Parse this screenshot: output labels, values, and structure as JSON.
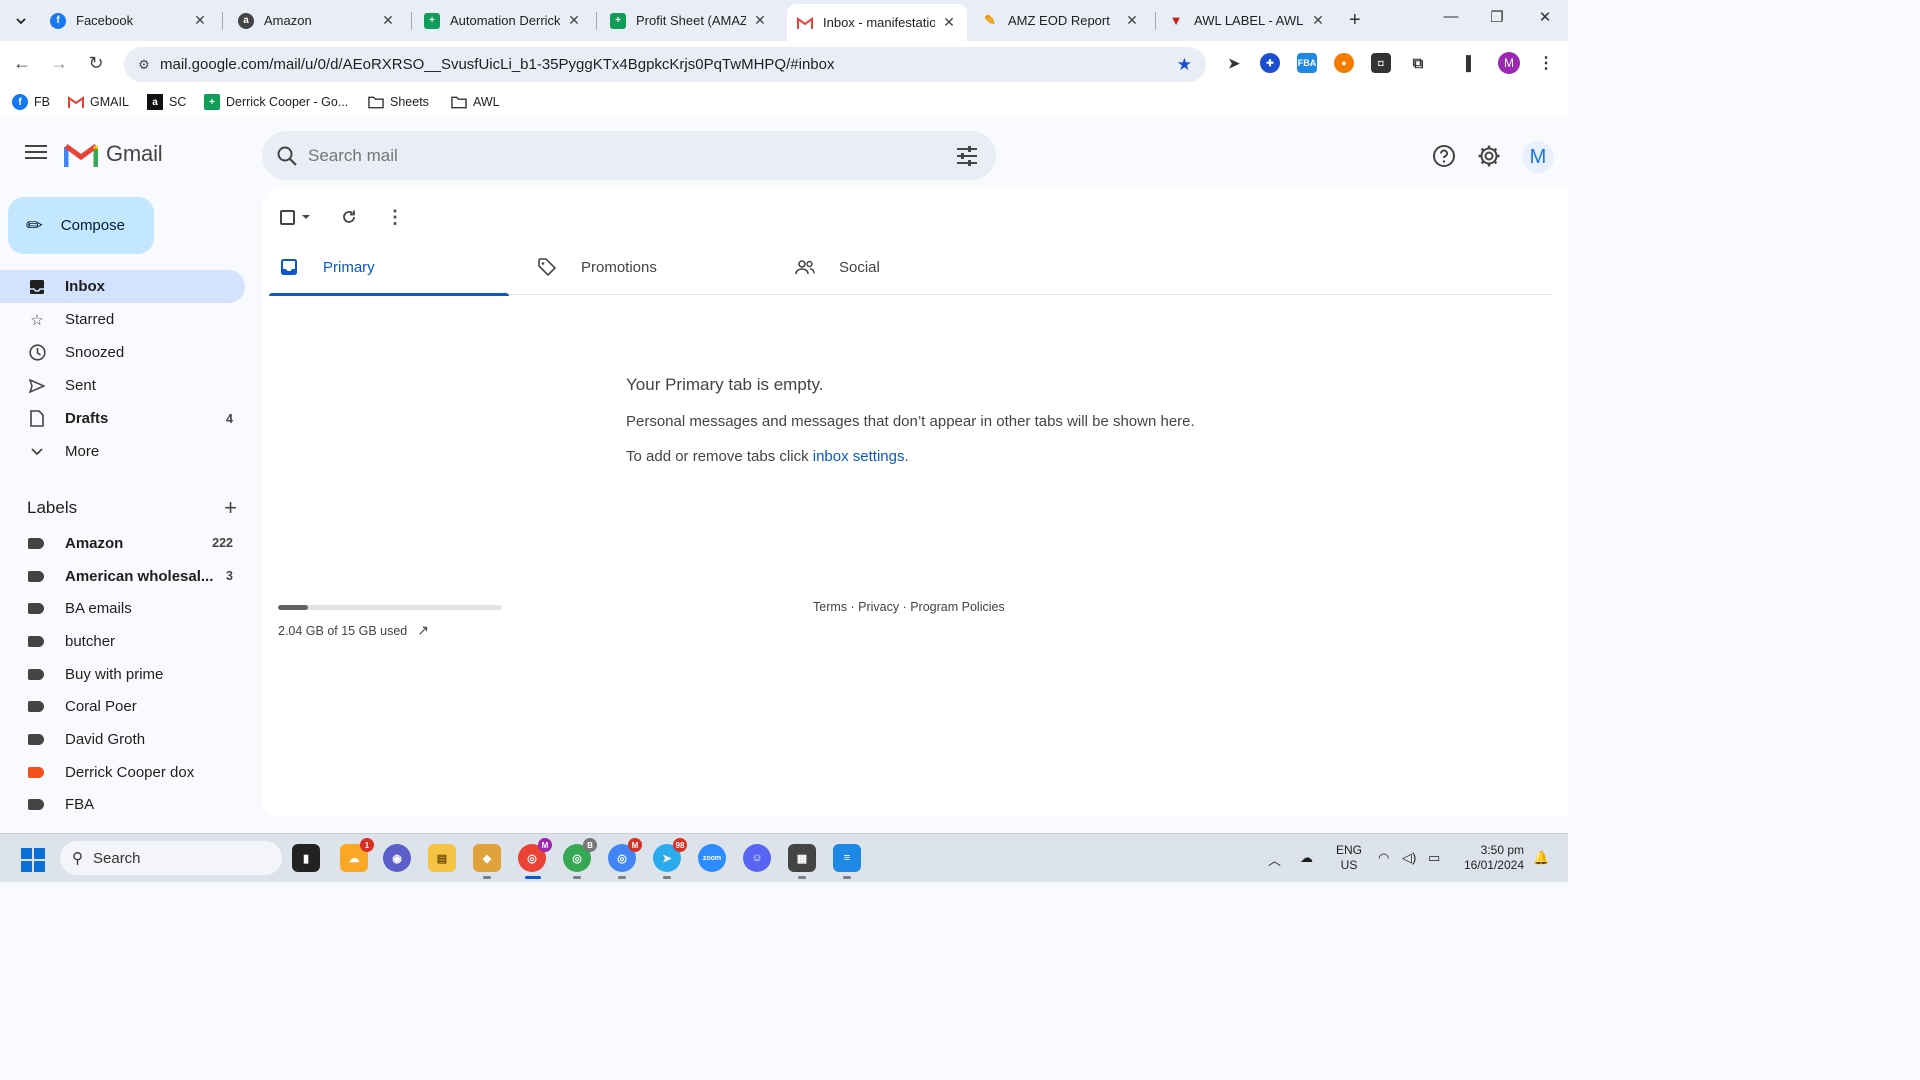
{
  "browser": {
    "tabs": [
      {
        "title": "Facebook",
        "favicon": "facebook-icon",
        "color": "#1877f2",
        "glyph": "f"
      },
      {
        "title": "Amazon",
        "favicon": "amazon-icon",
        "color": "#444444",
        "glyph": "a"
      },
      {
        "title": "Automation Derrick C",
        "favicon": "sheets-icon",
        "color": "#0f9d58",
        "glyph": "+"
      },
      {
        "title": "Profit Sheet (AMAZIN",
        "favicon": "sheets-icon",
        "color": "#0f9d58",
        "glyph": "+"
      },
      {
        "title": "Inbox - manifestation",
        "favicon": "gmail-icon",
        "color": "#ea4335",
        "glyph": "M"
      },
      {
        "title": "AMZ EOD Report",
        "favicon": "report-icon",
        "color": "#f29900",
        "glyph": "✎"
      },
      {
        "title": "AWL LABEL - AWL LA",
        "favicon": "awl-icon",
        "color": "#c5221f",
        "glyph": "▼"
      }
    ],
    "url": "mail.google.com/mail/u/0/d/AEoRXRSO__SvusfUicLi_b1-35PyggKTx4BgpkcKrjs0PqTwMHPQ/#inbox",
    "profile_initial": "M",
    "bookmarks": [
      {
        "label": "FB",
        "icon": "facebook-icon"
      },
      {
        "label": "GMAIL",
        "icon": "gmail-icon"
      },
      {
        "label": "SC",
        "icon": "amazon-icon"
      },
      {
        "label": "Derrick Cooper - Go...",
        "icon": "sheets-icon"
      },
      {
        "label": "Sheets",
        "icon": "folder-icon"
      },
      {
        "label": "AWL",
        "icon": "folder-icon"
      }
    ]
  },
  "gmail": {
    "app_name": "Gmail",
    "search_placeholder": "Search mail",
    "avatar_initial": "M",
    "compose_label": "Compose",
    "nav": [
      {
        "label": "Inbox",
        "icon": "inbox-icon",
        "count": ""
      },
      {
        "label": "Starred",
        "icon": "star-icon",
        "count": ""
      },
      {
        "label": "Snoozed",
        "icon": "clock-icon",
        "count": ""
      },
      {
        "label": "Sent",
        "icon": "send-icon",
        "count": ""
      },
      {
        "label": "Drafts",
        "icon": "draft-icon",
        "count": "4"
      },
      {
        "label": "More",
        "icon": "chevron-down-icon",
        "count": ""
      }
    ],
    "labels_title": "Labels",
    "labels": [
      {
        "name": "Amazon",
        "count": "222",
        "color": "#444746",
        "bold": true
      },
      {
        "name": "American wholesal...",
        "count": "3",
        "color": "#444746",
        "bold": true
      },
      {
        "name": "BA emails",
        "count": "",
        "color": "#444746",
        "bold": false
      },
      {
        "name": "butcher",
        "count": "",
        "color": "#444746",
        "bold": false
      },
      {
        "name": "Buy with prime",
        "count": "",
        "color": "#444746",
        "bold": false
      },
      {
        "name": "Coral Poer",
        "count": "",
        "color": "#444746",
        "bold": false
      },
      {
        "name": "David Groth",
        "count": "",
        "color": "#444746",
        "bold": false
      },
      {
        "name": "Derrick Cooper dox",
        "count": "",
        "color": "#f4511e",
        "bold": false
      },
      {
        "name": "FBA",
        "count": "",
        "color": "#444746",
        "bold": false
      }
    ],
    "category_tabs": [
      "Primary",
      "Promotions",
      "Social"
    ],
    "empty_title": "Your Primary tab is empty.",
    "empty_body": "Personal messages and messages that don’t appear in other tabs will be shown here.",
    "empty_settings_prefix": "To add or remove tabs click ",
    "empty_settings_link": "inbox settings",
    "empty_settings_suffix": ".",
    "storage_text": "2.04 GB of 15 GB used",
    "storage_fraction": 0.136,
    "footer": "Terms · Privacy · Program Policies"
  },
  "taskbar": {
    "search_placeholder": "Search",
    "lang_top": "ENG",
    "lang_bottom": "US",
    "time": "3:50 pm",
    "date": "16/01/2024",
    "badges": {
      "weather": "1",
      "chrome1": "M",
      "chrome2": "B",
      "chrome3": "M",
      "telegram": "98"
    }
  }
}
